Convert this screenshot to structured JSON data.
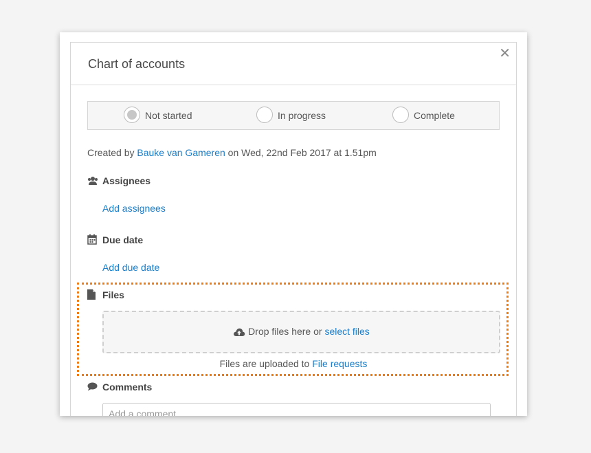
{
  "dialog": {
    "title": "Chart of accounts",
    "close_label": "✕"
  },
  "status": {
    "options": [
      {
        "label": "Not started",
        "selected": true
      },
      {
        "label": "In progress",
        "selected": false
      },
      {
        "label": "Complete",
        "selected": false
      }
    ]
  },
  "created": {
    "prefix": "Created by",
    "author": "Bauke van Gameren",
    "suffix": "on Wed, 22nd Feb 2017 at 1.51pm"
  },
  "assignees": {
    "heading": "Assignees",
    "icon": "users-icon",
    "action": "Add assignees"
  },
  "due_date": {
    "heading": "Due date",
    "icon": "calendar-icon",
    "action": "Add due date"
  },
  "files": {
    "heading": "Files",
    "icon": "file-icon",
    "drop_text": "Drop files here or",
    "select_link": "select files",
    "upload_icon": "cloud-upload-icon",
    "uploaded_prefix": "Files are uploaded to",
    "uploaded_link": "File requests"
  },
  "comments": {
    "heading": "Comments",
    "icon": "speech-bubble-icon",
    "placeholder": "Add a comment"
  },
  "colors": {
    "link": "#1a7ec9",
    "highlight": "#f07b10"
  }
}
